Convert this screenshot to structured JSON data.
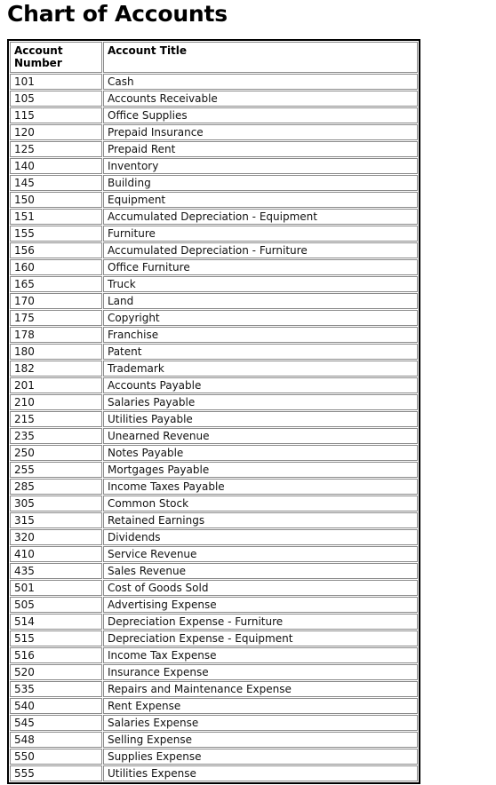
{
  "page": {
    "title": "Chart of Accounts",
    "background_color": "#ffffff",
    "text_color": "#000000",
    "border_color": "#000000"
  },
  "table": {
    "columns": [
      {
        "key": "number",
        "label": "Account Number"
      },
      {
        "key": "title",
        "label": "Account Title"
      }
    ],
    "rows": [
      {
        "number": "101",
        "title": "Cash"
      },
      {
        "number": "105",
        "title": "Accounts Receivable"
      },
      {
        "number": "115",
        "title": "Office Supplies"
      },
      {
        "number": "120",
        "title": "Prepaid Insurance"
      },
      {
        "number": "125",
        "title": "Prepaid Rent"
      },
      {
        "number": "140",
        "title": "Inventory"
      },
      {
        "number": "145",
        "title": "Building"
      },
      {
        "number": "150",
        "title": "Equipment"
      },
      {
        "number": "151",
        "title": "Accumulated Depreciation - Equipment"
      },
      {
        "number": "155",
        "title": "Furniture"
      },
      {
        "number": "156",
        "title": "Accumulated Depreciation - Furniture"
      },
      {
        "number": "160",
        "title": "Office Furniture"
      },
      {
        "number": "165",
        "title": "Truck"
      },
      {
        "number": "170",
        "title": "Land"
      },
      {
        "number": "175",
        "title": "Copyright"
      },
      {
        "number": "178",
        "title": "Franchise"
      },
      {
        "number": "180",
        "title": "Patent"
      },
      {
        "number": "182",
        "title": "Trademark"
      },
      {
        "number": "201",
        "title": "Accounts Payable"
      },
      {
        "number": "210",
        "title": "Salaries Payable"
      },
      {
        "number": "215",
        "title": "Utilities Payable"
      },
      {
        "number": "235",
        "title": "Unearned Revenue"
      },
      {
        "number": "250",
        "title": "Notes Payable"
      },
      {
        "number": "255",
        "title": "Mortgages Payable"
      },
      {
        "number": "285",
        "title": "Income Taxes Payable"
      },
      {
        "number": "305",
        "title": "Common Stock"
      },
      {
        "number": "315",
        "title": "Retained Earnings"
      },
      {
        "number": "320",
        "title": "Dividends"
      },
      {
        "number": "410",
        "title": "Service Revenue"
      },
      {
        "number": "435",
        "title": "Sales Revenue"
      },
      {
        "number": "501",
        "title": "Cost of Goods Sold"
      },
      {
        "number": "505",
        "title": "Advertising Expense"
      },
      {
        "number": "514",
        "title": "Depreciation Expense - Furniture"
      },
      {
        "number": "515",
        "title": "Depreciation Expense - Equipment"
      },
      {
        "number": "516",
        "title": "Income Tax Expense"
      },
      {
        "number": "520",
        "title": "Insurance Expense"
      },
      {
        "number": "535",
        "title": "Repairs and Maintenance Expense"
      },
      {
        "number": "540",
        "title": "Rent Expense"
      },
      {
        "number": "545",
        "title": "Salaries Expense"
      },
      {
        "number": "548",
        "title": "Selling Expense"
      },
      {
        "number": "550",
        "title": "Supplies Expense"
      },
      {
        "number": "555",
        "title": "Utilities Expense"
      }
    ]
  }
}
